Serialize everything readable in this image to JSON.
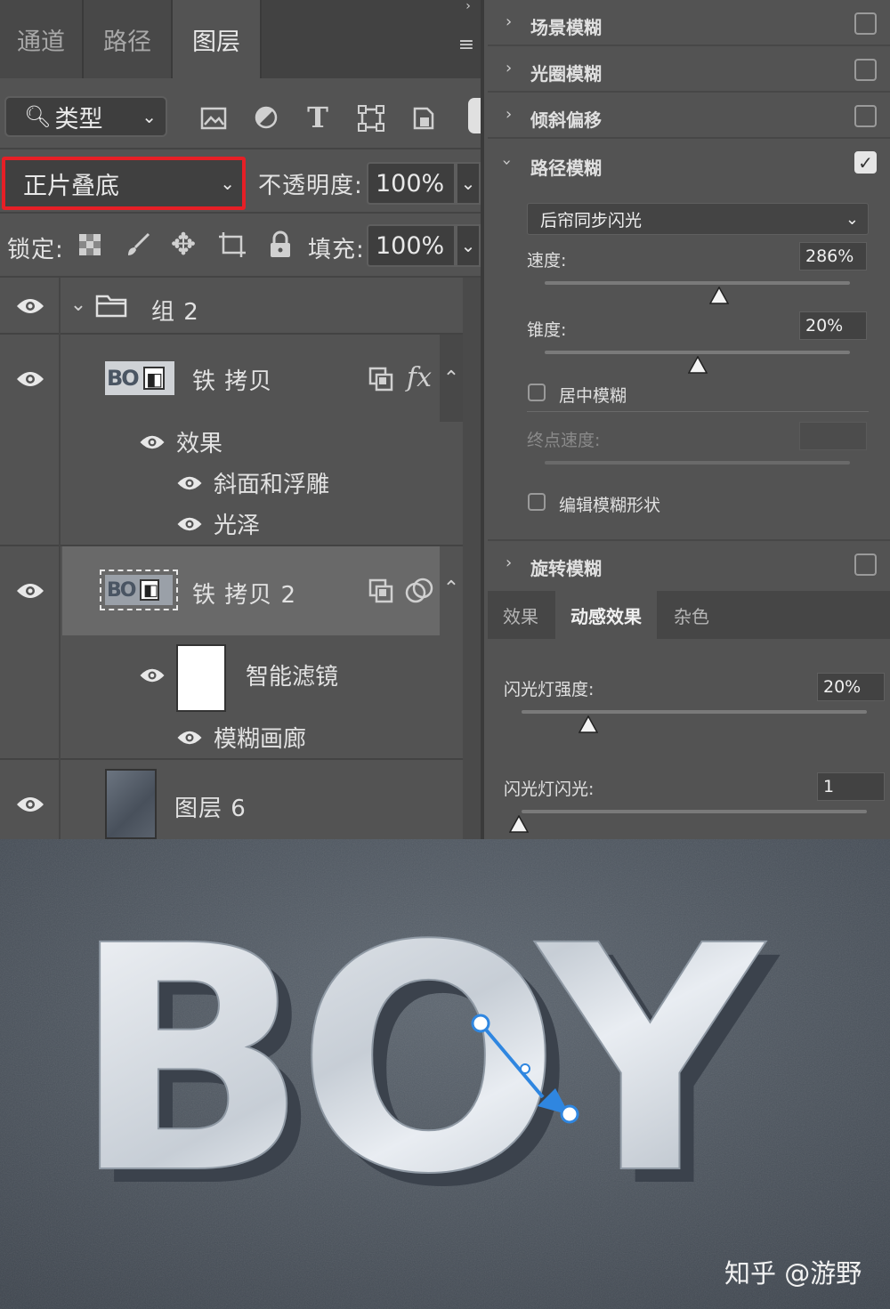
{
  "layers_panel": {
    "tabs": [
      {
        "label": "通道"
      },
      {
        "label": "路径"
      },
      {
        "label": "图层"
      }
    ],
    "filter": {
      "label": "类型"
    },
    "blend_mode": {
      "value": "正片叠底"
    },
    "opacity": {
      "label": "不透明度:",
      "value": "100%"
    },
    "lock": {
      "label": "锁定:"
    },
    "fill": {
      "label": "填充:",
      "value": "100%"
    },
    "group": {
      "name": "组 2"
    },
    "layer1": {
      "name": "铁 拷贝",
      "effects_label": "效果",
      "effects": [
        "斜面和浮雕",
        "光泽"
      ]
    },
    "layer2": {
      "name": "铁 拷贝 2",
      "smart_filter_label": "智能滤镜",
      "filter_item": "模糊画廊"
    },
    "layer3": {
      "name": "图层 6"
    }
  },
  "blur_gallery": {
    "sections": [
      {
        "title": "场景模糊",
        "checked": false
      },
      {
        "title": "光圈模糊",
        "checked": false
      },
      {
        "title": "倾斜偏移",
        "checked": false
      },
      {
        "title": "路径模糊",
        "checked": true
      },
      {
        "title": "旋转模糊",
        "checked": false
      }
    ],
    "path_blur": {
      "mode": "后帘同步闪光",
      "speed": {
        "label": "速度:",
        "value": "286%"
      },
      "taper": {
        "label": "锥度:",
        "value": "20%"
      },
      "centered": {
        "label": "居中模糊",
        "checked": false
      },
      "end_speed": {
        "label": "终点速度:",
        "value": ""
      },
      "edit_shape": {
        "label": "编辑模糊形状",
        "checked": false
      }
    },
    "bottom_tabs": [
      {
        "label": "效果"
      },
      {
        "label": "动感效果"
      },
      {
        "label": "杂色"
      }
    ],
    "strobe_strength": {
      "label": "闪光灯强度:",
      "value": "20%"
    },
    "strobe_flashes": {
      "label": "闪光灯闪光:",
      "value": "1"
    }
  },
  "canvas": {
    "text": "BOY",
    "watermark": "知乎 @游野",
    "colors": {
      "arrow": "#2f86e0",
      "highlight": "#e61f26"
    }
  }
}
